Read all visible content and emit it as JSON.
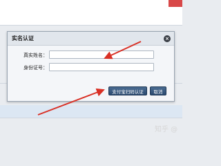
{
  "dialog": {
    "title": "实名认证",
    "close_glyph": "×",
    "fields": [
      {
        "label": "真实姓名：",
        "value": ""
      },
      {
        "label": "身份证号：",
        "value": ""
      }
    ],
    "buttons": {
      "alipay_verify": "支付宝扫码认证",
      "cancel": "取消"
    }
  },
  "watermark": "知乎 @",
  "colors": {
    "arrow": "#d93025",
    "button": "#2b4a70"
  },
  "icons": {
    "close": "close-icon",
    "annotation": "red-arrow-icon"
  }
}
